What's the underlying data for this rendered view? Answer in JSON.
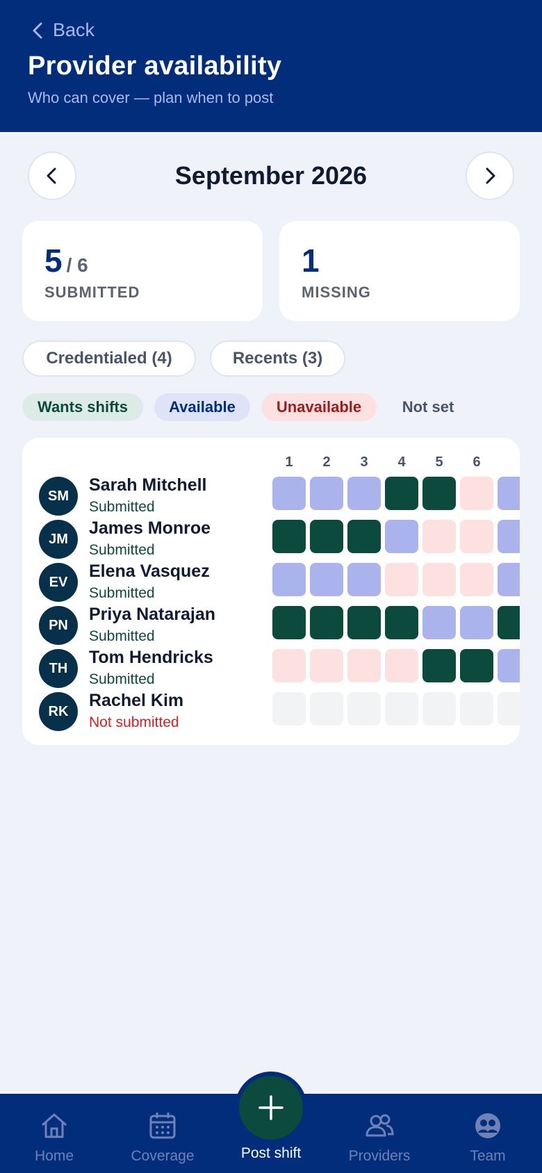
{
  "header": {
    "back_label": "Back",
    "title": "Provider availability",
    "subtitle": "Who can cover — plan when to post"
  },
  "month": {
    "label": "September 2026"
  },
  "stats": {
    "submitted": {
      "value": "5",
      "total": "/ 6",
      "label": "SUBMITTED"
    },
    "missing": {
      "value": "1",
      "label": "MISSING"
    }
  },
  "filters": [
    {
      "label": "Credentialed (4)"
    },
    {
      "label": "Recents (3)"
    }
  ],
  "legend": [
    {
      "key": "wants",
      "label": "Wants shifts",
      "bg": "#dcebe5",
      "fg": "#0b4a3c"
    },
    {
      "key": "available",
      "label": "Available",
      "bg": "#dfe3f7",
      "fg": "#022d7a"
    },
    {
      "key": "unavailable",
      "label": "Unavailable",
      "bg": "#fde0e0",
      "fg": "#9b1c1c"
    },
    {
      "key": "notset",
      "label": "Not set",
      "bg": "transparent",
      "fg": "#4a5468"
    }
  ],
  "cell_colors": {
    "W": "#0b4a3c",
    "A": "#aab3ec",
    "U": "#fde0e0",
    "N": "#f2f3f5"
  },
  "grid": {
    "days": [
      "1",
      "2",
      "3",
      "4",
      "5",
      "6"
    ],
    "providers": [
      {
        "initials": "SM",
        "name": "Sarah Mitchell",
        "status": "Submitted",
        "status_color": "#0b4a3c",
        "cells": [
          "A",
          "A",
          "A",
          "W",
          "W",
          "U",
          "A"
        ]
      },
      {
        "initials": "JM",
        "name": "James Monroe",
        "status": "Submitted",
        "status_color": "#0b4a3c",
        "cells": [
          "W",
          "W",
          "W",
          "A",
          "U",
          "U",
          "A"
        ]
      },
      {
        "initials": "EV",
        "name": "Elena Vasquez",
        "status": "Submitted",
        "status_color": "#0b4a3c",
        "cells": [
          "A",
          "A",
          "A",
          "U",
          "U",
          "U",
          "A"
        ]
      },
      {
        "initials": "PN",
        "name": "Priya Natarajan",
        "status": "Submitted",
        "status_color": "#0b4a3c",
        "cells": [
          "W",
          "W",
          "W",
          "W",
          "A",
          "A",
          "W"
        ]
      },
      {
        "initials": "TH",
        "name": "Tom Hendricks",
        "status": "Submitted",
        "status_color": "#0b4a3c",
        "cells": [
          "U",
          "U",
          "U",
          "U",
          "W",
          "W",
          "A"
        ]
      },
      {
        "initials": "RK",
        "name": "Rachel Kim",
        "status": "Not submitted",
        "status_color": "#d92020",
        "cells": [
          "N",
          "N",
          "N",
          "N",
          "N",
          "N",
          "N"
        ]
      }
    ]
  },
  "nav": {
    "items": [
      {
        "label": "Home",
        "icon": "home-icon"
      },
      {
        "label": "Coverage",
        "icon": "calendar-icon"
      },
      {
        "label": "Providers",
        "icon": "people-icon"
      },
      {
        "label": "Team",
        "icon": "team-icon"
      }
    ],
    "fab_label": "Post shift",
    "fab_icon": "plus-icon"
  }
}
